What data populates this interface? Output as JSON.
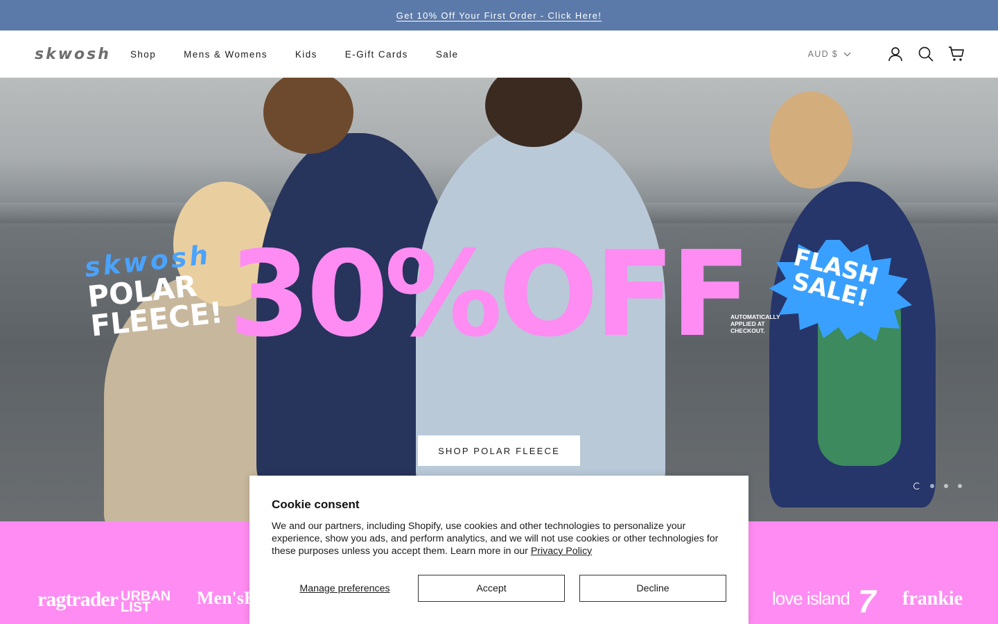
{
  "announcement": {
    "text": "Get 10% Off Your First Order - Click Here!"
  },
  "header": {
    "logo": "skwosh",
    "nav": [
      "Shop",
      "Mens & Womens",
      "Kids",
      "E-Gift Cards",
      "Sale"
    ],
    "currency": "AUD $",
    "icons": [
      "account-icon",
      "search-icon",
      "cart-icon"
    ]
  },
  "hero": {
    "promo_brand": "skwosh",
    "promo_line1": "POLAR",
    "promo_line2": "FLEECE!",
    "promo_big": "30%OFF",
    "promo_note": "AUTOMATICALLY APPLIED AT CHECKOUT.",
    "badge_line1": "FLASH",
    "badge_line2": "SALE!",
    "cta": "SHOP POLAR FLEECE",
    "slides_total": 4,
    "slide_active": 1
  },
  "press": {
    "logos": [
      "ragtrader",
      "URBAN LIST",
      "Men'sHealth",
      "love island",
      "7",
      "frankie"
    ]
  },
  "cookie": {
    "title": "Cookie consent",
    "body": "We and our partners, including Shopify, use cookies and other technologies to personalize your experience, show you ads, and perform analytics, and we will not use cookies or other technologies for these purposes unless you accept them. Learn more in our",
    "link": "Privacy Policy",
    "manage": "Manage preferences",
    "accept": "Accept",
    "decline": "Decline"
  },
  "colors": {
    "announce_bg": "#5b7aa9",
    "promo_pink": "#ff8cf2",
    "badge_blue": "#3aa0ff"
  }
}
